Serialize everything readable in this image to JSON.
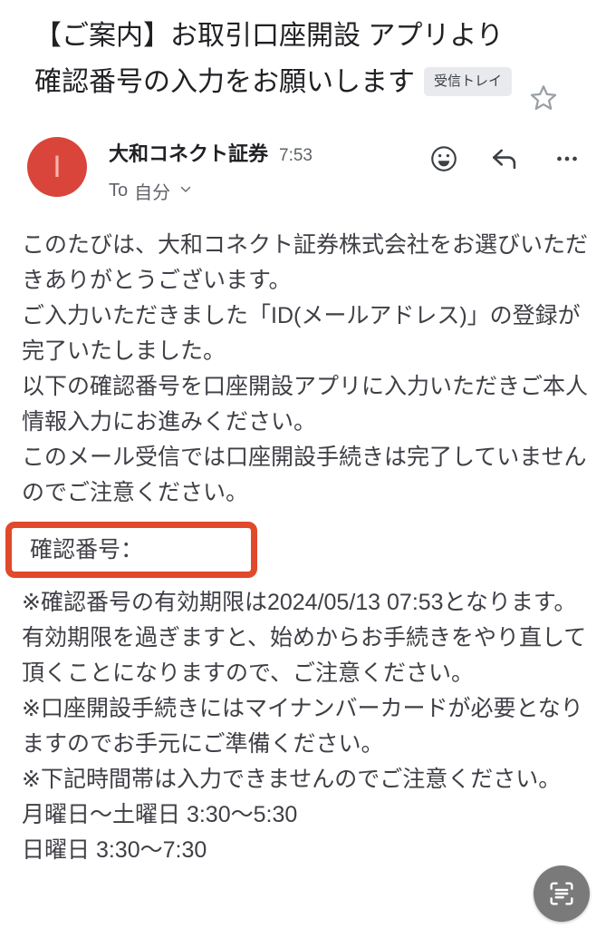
{
  "subject": {
    "text": "【ご案内】お取引口座開設 アプリより確認番号の入力をお願いします",
    "label_chip": "受信トレイ",
    "star_icon": "star-outline-icon"
  },
  "sender": {
    "avatar_initial": "I",
    "avatar_color": "#d9453a",
    "name": "大和コネクト証券",
    "time": "7:53",
    "recipient_prefix": "To",
    "recipient": "自分",
    "chevron": "⌄",
    "actions": [
      {
        "name": "emoji-react-icon",
        "label": "絵文字リアクション"
      },
      {
        "name": "reply-icon",
        "label": "返信"
      },
      {
        "name": "more-options-icon",
        "label": "その他"
      }
    ]
  },
  "body": {
    "paragraphs": [
      "このたびは、大和コネクト証券株式会社をお選びいただきありがとうございます。",
      "ご入力いただきました「ID(メールアドレス)」の登録が完了いたしました。",
      "以下の確認番号を口座開設アプリに入力いただきご本人情報入力にお進みください。",
      "このメール受信では口座開設手続きは完了していませんのでご注意ください。"
    ],
    "code_box": {
      "label": "確認番号：",
      "value": "",
      "border_color": "#e0492a"
    },
    "paragraphs_after": [
      "※確認番号の有効期限は2024/05/13 07:53となります。",
      "有効期限を過ぎますと、始めからお手続きをやり直して頂くことになりますので、ご注意ください。",
      "※口座開設手続きにはマイナンバーカードが必要となりますのでお手元にご準備ください。",
      "※下記時間帯は入力できませんのでご注意ください。",
      "月曜日〜土曜日 3:30〜5:30",
      "日曜日 3:30〜7:30"
    ]
  },
  "fab": {
    "icon": "scan-text-icon",
    "color": "#7a7a7a"
  }
}
